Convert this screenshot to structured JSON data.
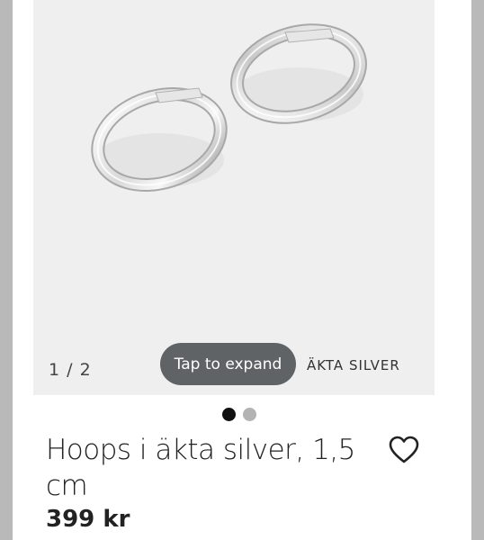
{
  "gallery": {
    "image_counter": "1 / 2",
    "expand_label": "Tap to expand",
    "badge": "ÄKTA SILVER",
    "image_description_icon": "hoop-earrings-image",
    "dots": [
      {
        "active": true
      },
      {
        "active": false
      }
    ]
  },
  "product": {
    "title": "Hoops i äkta silver, 1,5 cm",
    "price": "399 kr",
    "wishlist_icon": "heart-icon"
  }
}
